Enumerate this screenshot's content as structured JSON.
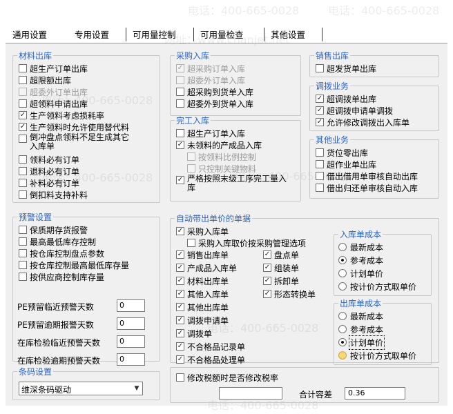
{
  "tabs": [
    "通用设置",
    "专用设置",
    "可用量控制",
    "可用量检查",
    "其他设置"
  ],
  "watermark": [
    "电话：400-665-0028",
    "网址：www.chanjet.net"
  ],
  "material_out": {
    "title": "材料出库",
    "items": [
      {
        "label": "超生产订单出库",
        "checked": false,
        "disabled": false
      },
      {
        "label": "超限额出库",
        "checked": false,
        "disabled": false
      },
      {
        "label": "超委外订单出库",
        "checked": false,
        "disabled": true
      },
      {
        "label": "超领料申请出库",
        "checked": false,
        "disabled": false
      },
      {
        "label": "生产领料考虑损耗率",
        "checked": true,
        "disabled": false
      },
      {
        "label": "生产领料时允许使用替代料",
        "checked": true,
        "disabled": false
      },
      {
        "label": "倒冲盘点领料不足生成其它入库单",
        "checked": false,
        "disabled": false
      },
      {
        "label": "领料必有订单",
        "checked": false,
        "disabled": false
      },
      {
        "label": "退料必有订单",
        "checked": false,
        "disabled": false
      },
      {
        "label": "补料必有订单",
        "checked": false,
        "disabled": false
      },
      {
        "label": "倒扣料支持补料",
        "checked": false,
        "disabled": false
      }
    ]
  },
  "purchase_in": {
    "title": "采购入库",
    "items": [
      {
        "label": "超采购订单入库",
        "checked": true,
        "disabled": true
      },
      {
        "label": "超委外订单入库",
        "checked": false,
        "disabled": true
      },
      {
        "label": "超采购到货单入库",
        "checked": false,
        "disabled": false
      },
      {
        "label": "超委外到货单入库",
        "checked": false,
        "disabled": false
      }
    ]
  },
  "finished_in": {
    "title": "完工入库",
    "items": [
      {
        "label": "超生产订单入库",
        "checked": false,
        "disabled": false
      },
      {
        "label": "未领料的产成品入库",
        "checked": true,
        "disabled": false
      },
      {
        "label": "按领料比例控制",
        "checked": false,
        "disabled": true
      },
      {
        "label": "只控制关键物料",
        "checked": false,
        "disabled": true
      },
      {
        "label": "严格按照末级工序完工量入库",
        "checked": true,
        "disabled": false
      }
    ]
  },
  "sales_out": {
    "title": "销售出库",
    "items": [
      {
        "label": "超发货单出库",
        "checked": false,
        "disabled": false
      }
    ]
  },
  "transfer": {
    "title": "调拨业务",
    "items": [
      {
        "label": "超调拨单出库",
        "checked": true,
        "disabled": false
      },
      {
        "label": "超调拨申请单调拨",
        "checked": true,
        "disabled": false
      },
      {
        "label": "允许修改调拨出入库单",
        "checked": true,
        "disabled": false
      }
    ]
  },
  "other_biz": {
    "title": "其他业务",
    "items": [
      {
        "label": "货位零出库",
        "checked": false,
        "disabled": false
      },
      {
        "label": "超作业单出库",
        "checked": false,
        "disabled": false
      },
      {
        "label": "借出借用单审核自动出库",
        "checked": false,
        "disabled": false
      },
      {
        "label": "借出归还单审核自动入库",
        "checked": false,
        "disabled": false
      }
    ]
  },
  "alerts": {
    "title": "预警设置",
    "items": [
      {
        "label": "保质期存货报警",
        "checked": false,
        "disabled": false
      },
      {
        "label": "最高最低库存控制",
        "checked": false,
        "disabled": false
      },
      {
        "label": "按仓库控制盘点参数",
        "checked": false,
        "disabled": false
      },
      {
        "label": "按仓库控制最高最低库存量",
        "checked": false,
        "disabled": false
      },
      {
        "label": "按供应商控制库存量",
        "checked": false,
        "disabled": false
      }
    ],
    "fields": [
      {
        "label": "PE预留临近预警天数",
        "value": "0"
      },
      {
        "label": "PE预留逾期报警天数",
        "value": "0"
      },
      {
        "label": "在库检验临近预警天数",
        "value": "0"
      },
      {
        "label": "在库检验逾期预警天数",
        "value": "0"
      }
    ]
  },
  "barcode": {
    "title": "条码设置",
    "driver": "维深条码驱动"
  },
  "auto_price": {
    "title": "自动带出单价的单据",
    "col1": [
      {
        "label": "采购入库单",
        "checked": true
      },
      {
        "label": "采购入库取价按采购管理选项",
        "checked": false
      },
      {
        "label": "销售出库单",
        "checked": true
      },
      {
        "label": "产成品入库单",
        "checked": true
      },
      {
        "label": "材料出库单",
        "checked": true
      },
      {
        "label": "其他入库单",
        "checked": true
      },
      {
        "label": "其他出库单",
        "checked": true
      },
      {
        "label": "调拨申请单",
        "checked": true
      },
      {
        "label": "调拨单",
        "checked": true
      },
      {
        "label": "不合格品记录单",
        "checked": true
      },
      {
        "label": "不合格品处理单",
        "checked": true
      }
    ],
    "col2": [
      {
        "label": "盘点单",
        "checked": true
      },
      {
        "label": "组装单",
        "checked": true
      },
      {
        "label": "拆卸单",
        "checked": true
      },
      {
        "label": "形态转换单",
        "checked": true
      }
    ]
  },
  "in_cost": {
    "title": "入库单成本",
    "options": [
      "最新成本",
      "参考成本",
      "计划单价",
      "按计价方式取单价"
    ],
    "selected": 1
  },
  "out_cost": {
    "title": "出库单成本",
    "options": [
      "最新成本",
      "参考成本",
      "计划单价",
      "按计价方式取单价"
    ],
    "selected": 2
  },
  "tax": {
    "label": "修改税额时是否修改税率",
    "checked": false
  },
  "tolerance": {
    "label": "合计容差",
    "value": "0.36"
  }
}
